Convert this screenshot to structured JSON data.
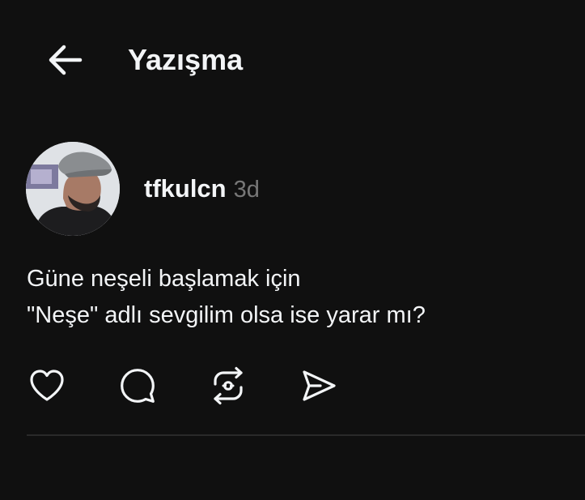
{
  "header": {
    "back_icon": "arrow-left-icon",
    "title": "Yazışma"
  },
  "post": {
    "author": {
      "username": "tfkulcn",
      "time_ago": "3d",
      "avatar": "profile-photo"
    },
    "text_lines": [
      "Güne neşeli başlamak için",
      "\"Neşe\" adlı sevgilim olsa ise yarar mı?"
    ],
    "actions": [
      {
        "name": "like",
        "icon": "heart-icon"
      },
      {
        "name": "reply",
        "icon": "comment-bubble-icon"
      },
      {
        "name": "repost",
        "icon": "repost-icon"
      },
      {
        "name": "share",
        "icon": "send-icon"
      }
    ]
  },
  "colors": {
    "background": "#101010",
    "text_primary": "#f3f5f7",
    "text_secondary": "#777777",
    "divider": "#2a2a2a"
  }
}
